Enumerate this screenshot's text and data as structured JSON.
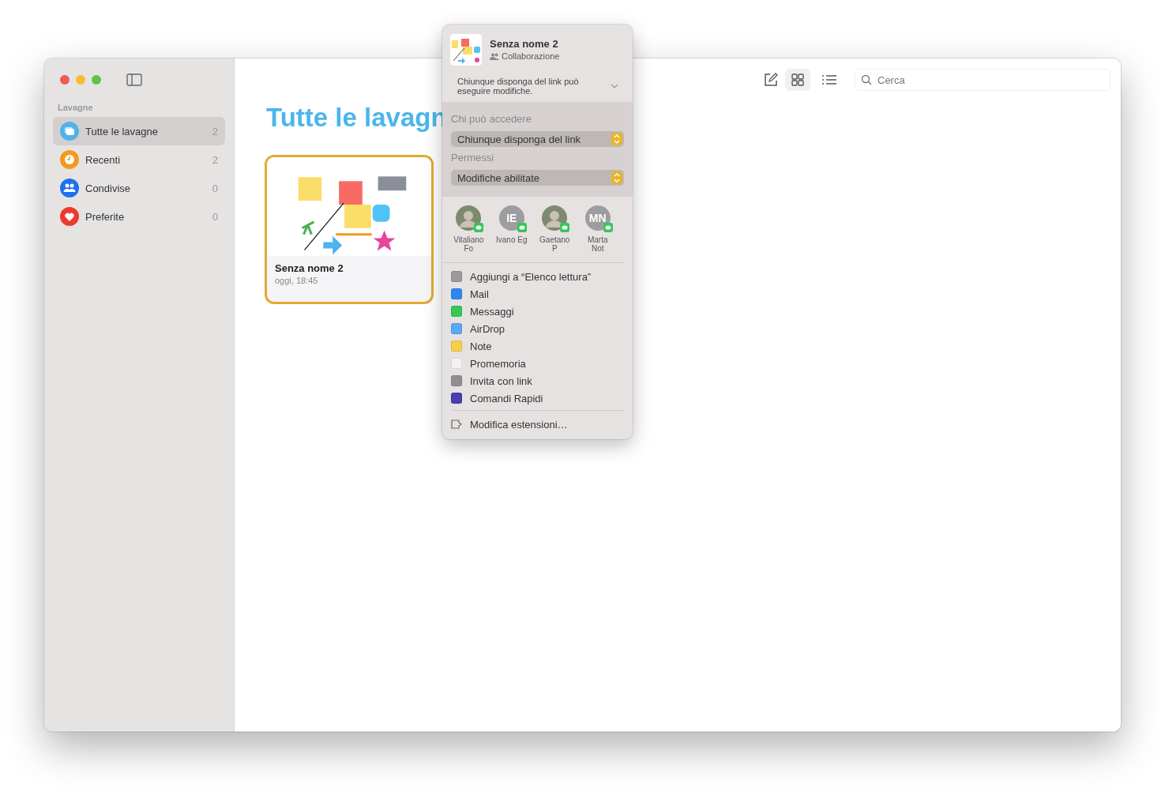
{
  "sidebar": {
    "section": "Lavagne",
    "items": [
      {
        "label": "Tutte le lavagne",
        "count": "2",
        "selected": true,
        "color": "#4fb3e8",
        "kind": "boards"
      },
      {
        "label": "Recenti",
        "count": "2",
        "selected": false,
        "color": "#f39a1e",
        "kind": "clock"
      },
      {
        "label": "Condivise",
        "count": "0",
        "selected": false,
        "color": "#1f6ff2",
        "kind": "people"
      },
      {
        "label": "Preferite",
        "count": "0",
        "selected": false,
        "color": "#ec3a2f",
        "kind": "heart"
      }
    ]
  },
  "toolbar": {
    "view_buttons": [
      {
        "kind": "grid",
        "selected": true
      },
      {
        "kind": "list",
        "selected": false
      }
    ],
    "search": {
      "placeholder": "Cerca"
    }
  },
  "content": {
    "title": "Tutte le lavagn",
    "boards": [
      {
        "name": "Senza nome 2",
        "date": "oggi, 18:45",
        "selected": true
      }
    ]
  },
  "share_popover": {
    "title": "Senza nome 2",
    "subtitle": "Collaborazione",
    "summary": "Chiunque disponga del link può eseguire modifiche.",
    "access_label": "Chi può accedere",
    "access_value": "Chiunque disponga del link",
    "permissions_label": "Permessi",
    "permissions_value": "Modifiche abilitate",
    "contacts": [
      {
        "name": "Vitaliano",
        "line2": "Fo",
        "kind": "photo"
      },
      {
        "name": "Ivano Eg",
        "kind": "initials",
        "initials": "IE"
      },
      {
        "name": "Gaetano",
        "line2": "P",
        "kind": "photo"
      },
      {
        "name": "Marta",
        "line2": "Not",
        "kind": "initials",
        "initials": "MN"
      }
    ],
    "actions": [
      {
        "label": "Aggiungi a “Elenco lettura”",
        "color": "#9a9a9e"
      },
      {
        "label": "Mail",
        "color": "#2f86f0"
      },
      {
        "label": "Messaggi",
        "color": "#34c759"
      },
      {
        "label": "AirDrop",
        "color": "#5aa9f5"
      },
      {
        "label": "Note",
        "color": "#f5d047"
      },
      {
        "label": "Promemoria",
        "color": "#f2f2f2"
      },
      {
        "label": "Invita con link",
        "color": "#8e8e93"
      },
      {
        "label": "Comandi Rapidi",
        "color": "#4a3fb0"
      }
    ],
    "footer": "Modifica estensioni…"
  }
}
